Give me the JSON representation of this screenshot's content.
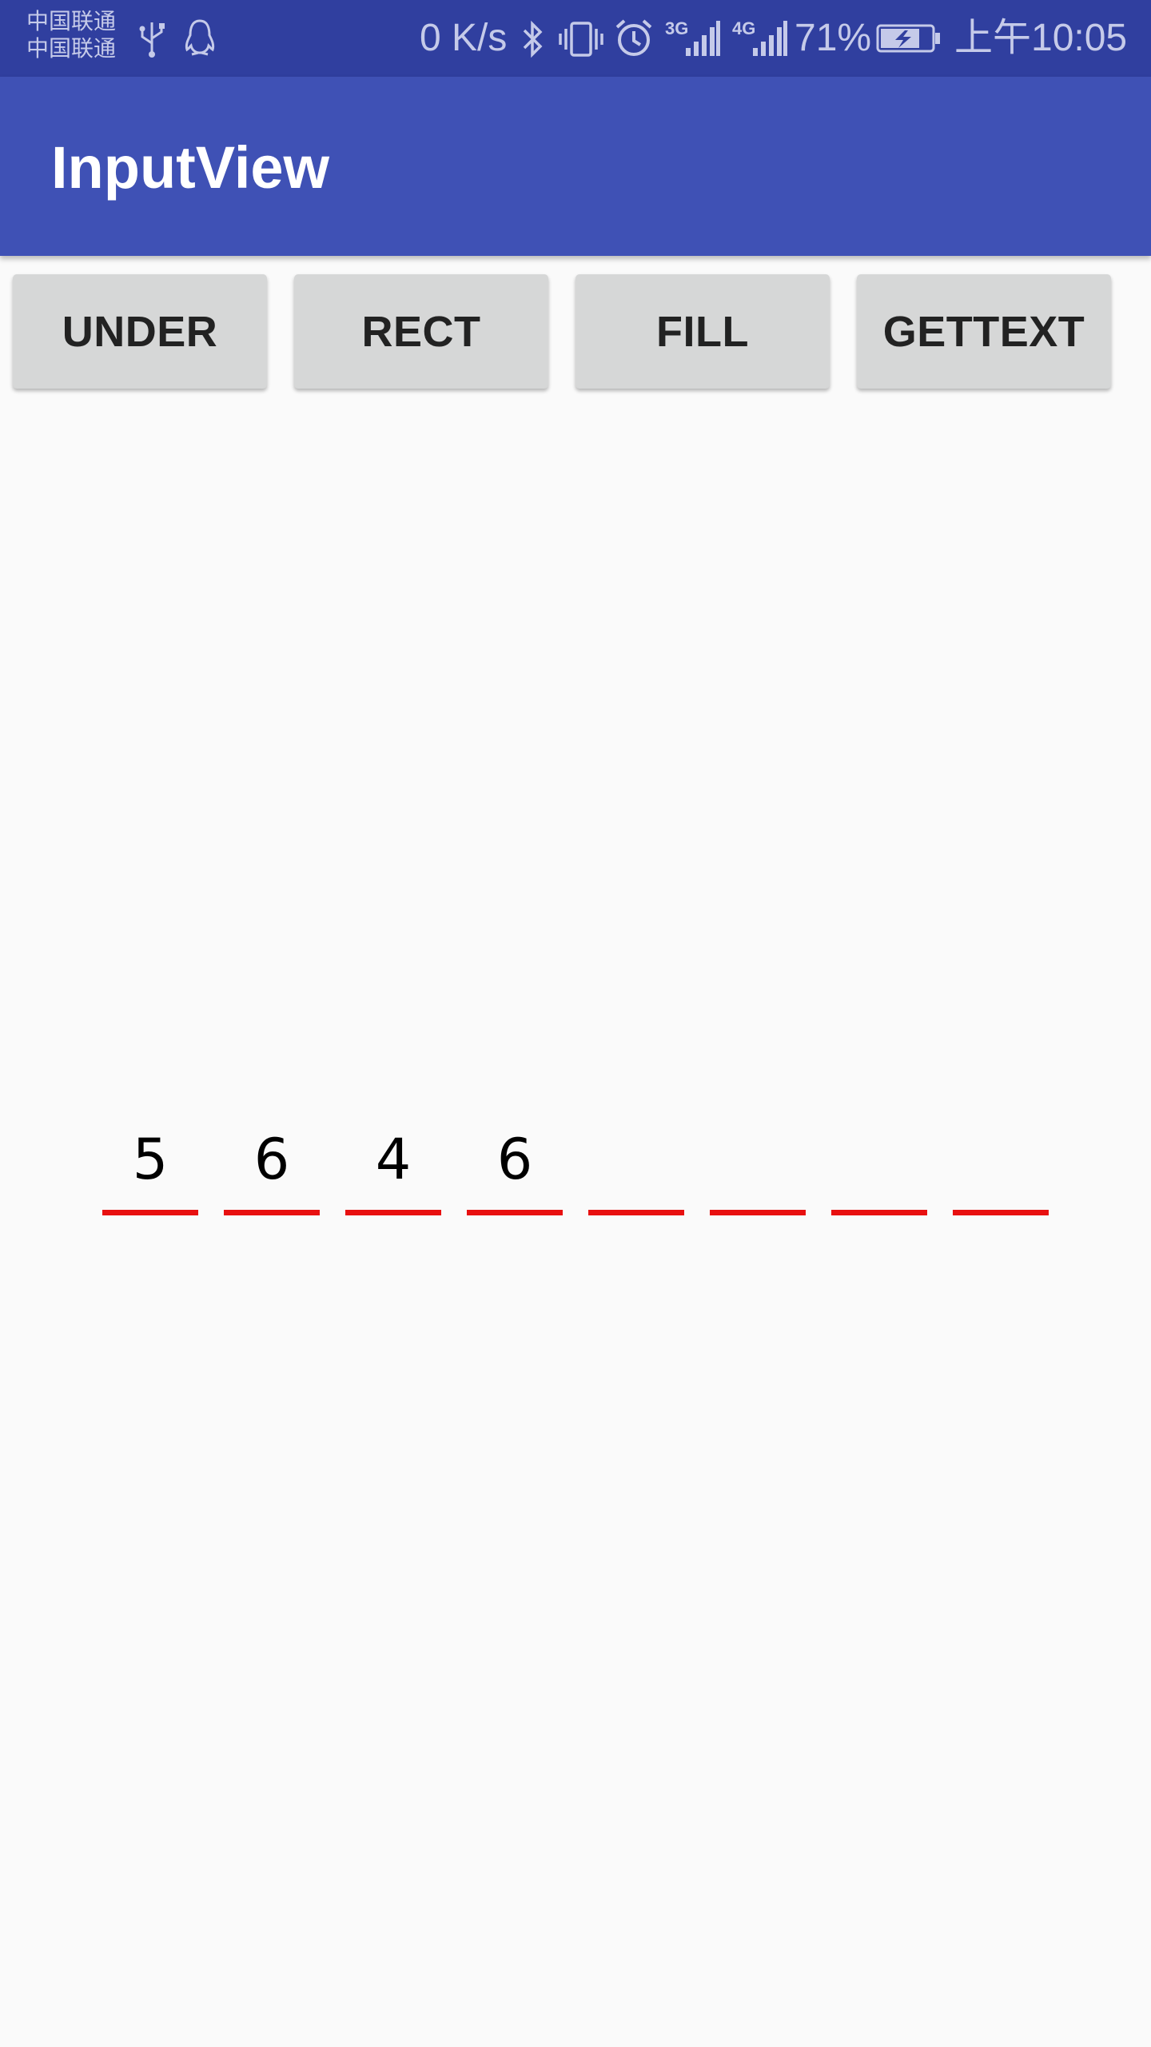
{
  "status_bar": {
    "carrier_1": "中国联通",
    "carrier_2": "中国联通",
    "net_speed": "0 K/s",
    "net_3g": "3G",
    "net_4g": "4G",
    "battery": "71%",
    "time": "上午10:05",
    "icons": [
      "usb-icon",
      "qq-icon",
      "bluetooth-icon",
      "vibrate-icon",
      "alarm-icon",
      "signal-3g-icon",
      "signal-4g-icon",
      "battery-charging-icon"
    ]
  },
  "app_bar": {
    "title": "InputView"
  },
  "buttons": [
    {
      "label": "UNDER"
    },
    {
      "label": "RECT"
    },
    {
      "label": "FILL"
    },
    {
      "label": "GETTEXT"
    }
  ],
  "code_input": {
    "digits": [
      "5",
      "6",
      "4",
      "6",
      "",
      "",
      "",
      ""
    ],
    "underline_color": "#e81010"
  },
  "colors": {
    "status_bar": "#303f9f",
    "primary": "#3f51b5",
    "background": "#fafafa",
    "button": "#d6d7d7"
  }
}
